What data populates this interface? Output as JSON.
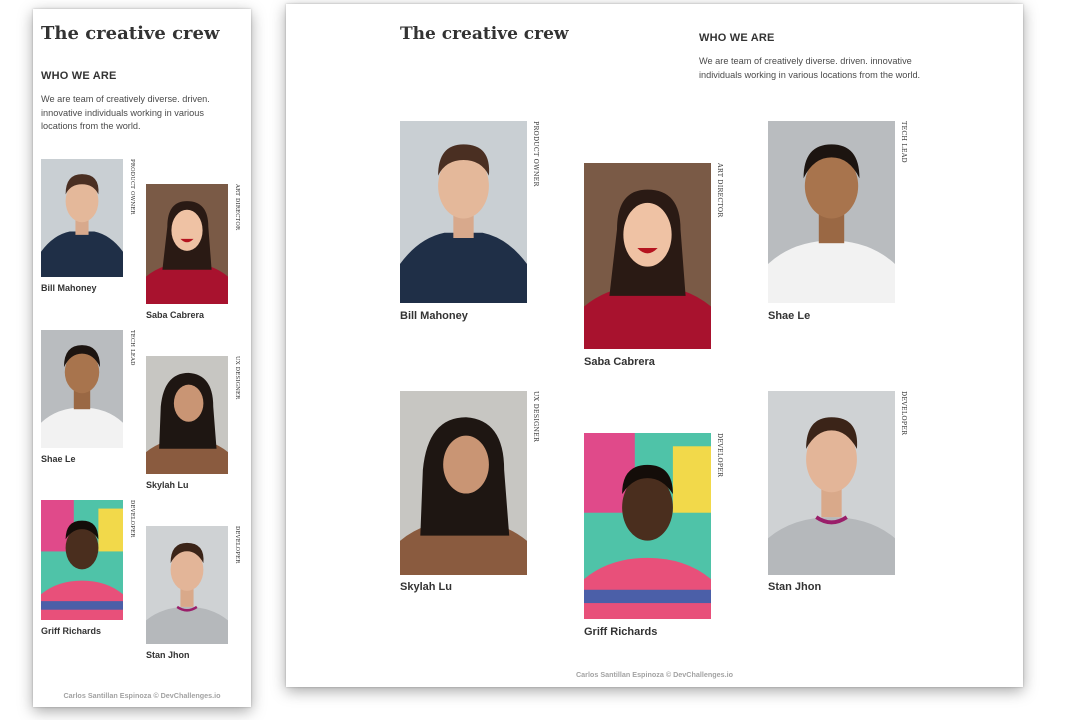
{
  "page": {
    "title": "The creative crew",
    "heading": "WHO WE ARE",
    "description": "We are team of creatively diverse. driven. innovative individuals working in various locations from the world.",
    "footer": "Carlos Santillan Espinoza © DevChallenges.io"
  },
  "members": [
    {
      "name": "Bill Mahoney",
      "role": "PRODUCT OWNER"
    },
    {
      "name": "Saba Cabrera",
      "role": "ART DIRECTOR"
    },
    {
      "name": "Shae Le",
      "role": "TECH LEAD"
    },
    {
      "name": "Skylah Lu",
      "role": "UX DESIGNER"
    },
    {
      "name": "Griff Richards",
      "role": "DEVELOPER"
    },
    {
      "name": "Stan Jhon",
      "role": "DEVELOPER"
    }
  ],
  "colors": {
    "page_background": "#ffffff",
    "text": "#333333",
    "footer_text": "#a3a3a3"
  }
}
